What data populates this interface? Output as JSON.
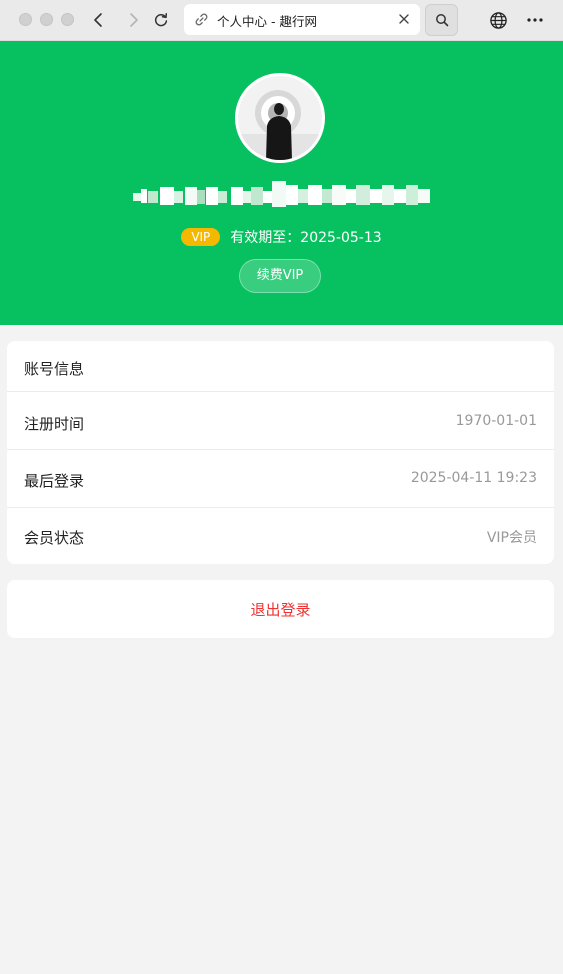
{
  "browser": {
    "tab_title": "个人中心 - 趣行网",
    "icons": {
      "back": "chevron-left-icon",
      "forward": "chevron-right-icon",
      "reload": "reload-icon",
      "link": "link-icon",
      "close": "close-icon",
      "search": "search-icon",
      "globe": "globe-icon",
      "more": "more-icon"
    }
  },
  "profile": {
    "avatar": "avatar-photo",
    "username_redacted": true,
    "vip_badge": "VIP",
    "vip_expire": "有效期至：2025-05-13",
    "renew_button": "续费VIP"
  },
  "account": {
    "title": "账号信息",
    "rows": [
      {
        "label": "注册时间",
        "value": "1970-01-01"
      },
      {
        "label": "最后登录",
        "value": "2025-04-11 19:23"
      },
      {
        "label": "会员状态",
        "value": "VIP会员"
      }
    ]
  },
  "actions": {
    "logout": "退出登录"
  },
  "colors": {
    "primary": "#07c160",
    "vip_badge": "#f5b800",
    "logout": "#ee3333",
    "page_bg": "#f3f3f3"
  }
}
